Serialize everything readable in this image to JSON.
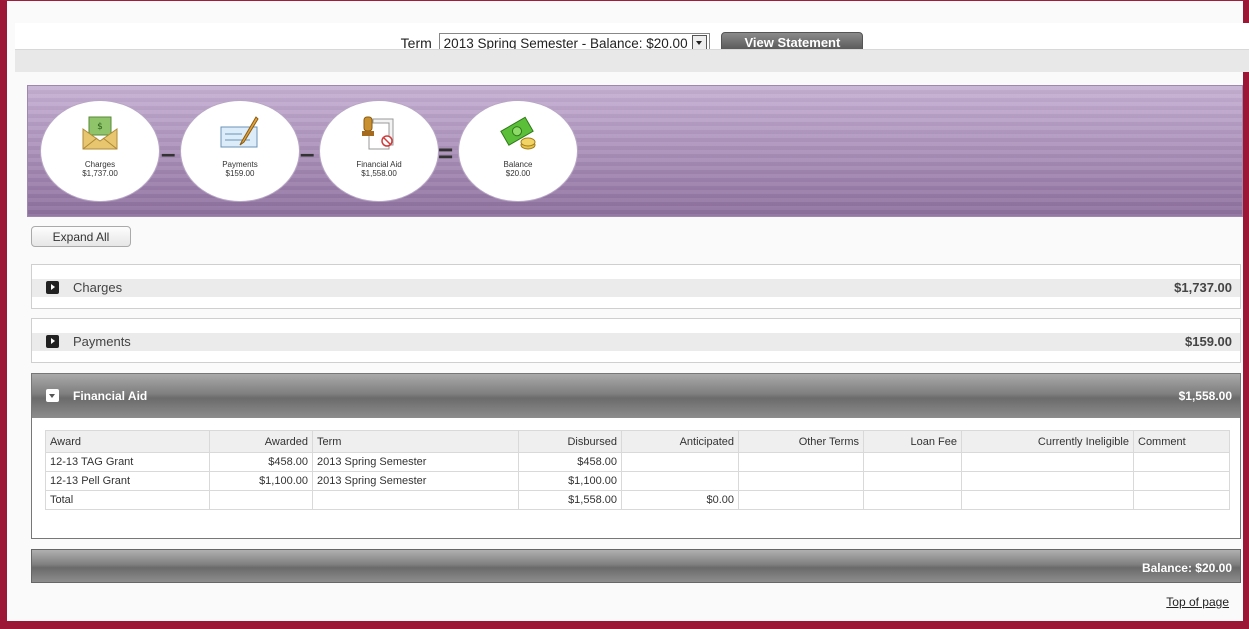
{
  "term": {
    "label": "Term",
    "selected": "2013 Spring Semester - Balance: $20.00",
    "view_button": "View Statement"
  },
  "summary": {
    "items": [
      {
        "label": "Charges",
        "amount": "$1,737.00",
        "icon": "envelope-money-icon"
      },
      {
        "label": "Payments",
        "amount": "$159.00",
        "icon": "check-pen-icon"
      },
      {
        "label": "Financial Aid",
        "amount": "$1,558.00",
        "icon": "documents-stamp-icon"
      },
      {
        "label": "Balance",
        "amount": "$20.00",
        "icon": "money-coins-icon"
      }
    ],
    "operators": [
      "–",
      "–",
      "="
    ]
  },
  "expand_all": "Expand All",
  "sections": {
    "charges": {
      "title": "Charges",
      "amount": "$1,737.00"
    },
    "payments": {
      "title": "Payments",
      "amount": "$159.00"
    },
    "financial_aid": {
      "title": "Financial Aid",
      "amount": "$1,558.00"
    }
  },
  "aid_table": {
    "headers": [
      "Award",
      "Awarded",
      "Term",
      "Disbursed",
      "Anticipated",
      "Other Terms",
      "Loan Fee",
      "Currently Ineligible",
      "Comment"
    ],
    "rows": [
      [
        "12-13 TAG Grant",
        "$458.00",
        "2013 Spring Semester",
        "$458.00",
        "",
        "",
        "",
        "",
        ""
      ],
      [
        "12-13 Pell Grant",
        "$1,100.00",
        "2013 Spring Semester",
        "$1,100.00",
        "",
        "",
        "",
        "",
        ""
      ],
      [
        "Total",
        "",
        "",
        "$1,558.00",
        "$0.00",
        "",
        "",
        "",
        ""
      ]
    ]
  },
  "balance_footer": "Balance: $20.00",
  "top_link": "Top of page",
  "colors": {
    "frame": "#9c1736",
    "banner_top": "#c7b1d4",
    "banner_bottom": "#8e719f"
  }
}
